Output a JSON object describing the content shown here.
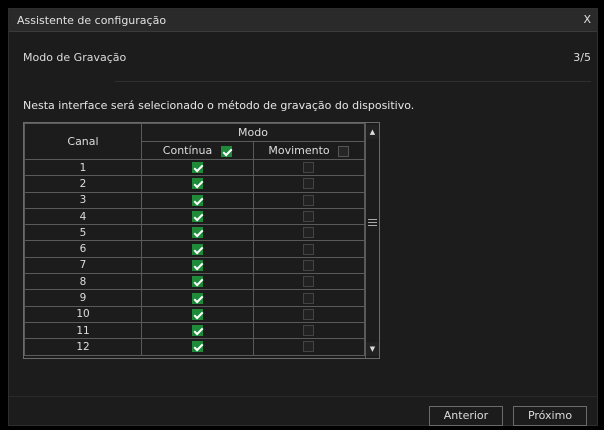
{
  "window": {
    "title": "Assistente de configuração",
    "close_label": "X"
  },
  "step": {
    "title": "Modo de Gravação",
    "counter": "3/5"
  },
  "description": "Nesta interface será selecionado o método de gravação do dispositivo.",
  "table": {
    "col_canal": "Canal",
    "group_modo": "Modo",
    "col_continua": "Contínua",
    "col_movimento": "Movimento",
    "header_continua_checked": true,
    "header_movimento_checked": false,
    "rows": [
      {
        "canal": "1",
        "continua": true,
        "movimento": false
      },
      {
        "canal": "2",
        "continua": true,
        "movimento": false
      },
      {
        "canal": "3",
        "continua": true,
        "movimento": false
      },
      {
        "canal": "4",
        "continua": true,
        "movimento": false
      },
      {
        "canal": "5",
        "continua": true,
        "movimento": false
      },
      {
        "canal": "6",
        "continua": true,
        "movimento": false
      },
      {
        "canal": "7",
        "continua": true,
        "movimento": false
      },
      {
        "canal": "8",
        "continua": true,
        "movimento": false
      },
      {
        "canal": "9",
        "continua": true,
        "movimento": false
      },
      {
        "canal": "10",
        "continua": true,
        "movimento": false
      },
      {
        "canal": "11",
        "continua": true,
        "movimento": false
      },
      {
        "canal": "12",
        "continua": true,
        "movimento": false
      }
    ]
  },
  "buttons": {
    "previous": "Anterior",
    "next": "Próximo"
  },
  "colors": {
    "accent_green": "#1f8a3a",
    "background": "#1c1c1c"
  }
}
